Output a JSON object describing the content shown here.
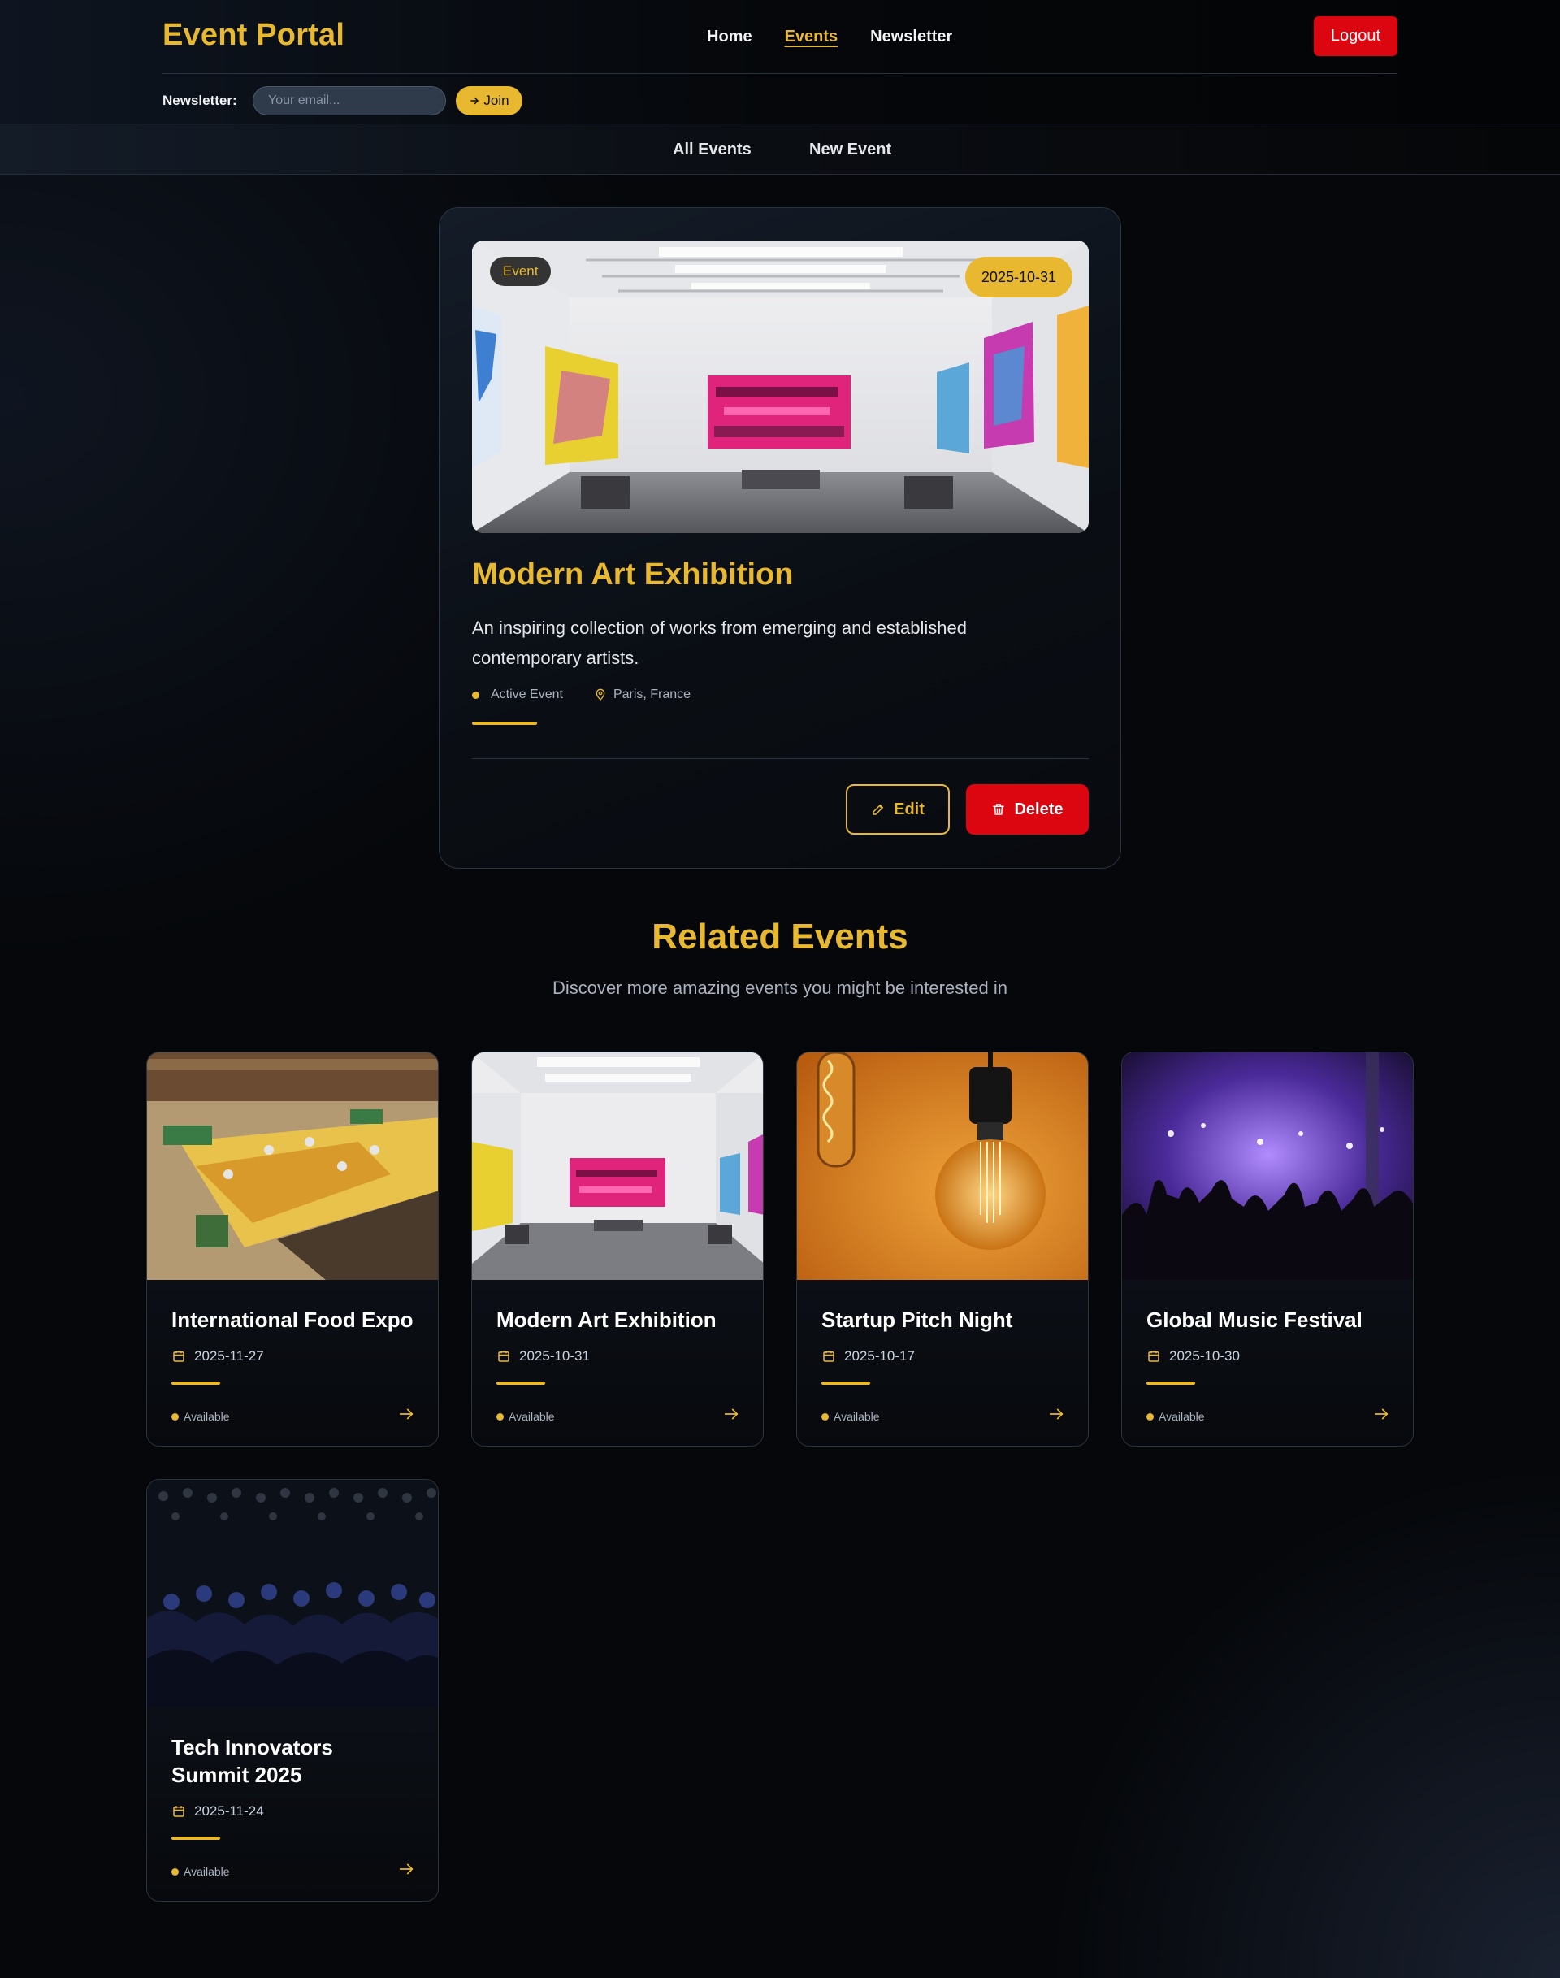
{
  "header": {
    "brand": "Event Portal",
    "nav": [
      {
        "label": "Home",
        "active": false
      },
      {
        "label": "Events",
        "active": true
      },
      {
        "label": "Newsletter",
        "active": false
      }
    ],
    "logout_label": "Logout",
    "newsletter_label": "Newsletter:",
    "newsletter_placeholder": "Your email...",
    "join_label": "Join"
  },
  "subnav": {
    "items": [
      {
        "label": "All Events"
      },
      {
        "label": "New Event"
      }
    ]
  },
  "event": {
    "badge": "Event",
    "date": "2025-10-31",
    "title": "Modern Art Exhibition",
    "description": "An inspiring collection of works from emerging and established contemporary artists.",
    "status": "Active Event",
    "location": "Paris, France",
    "edit_label": "Edit",
    "delete_label": "Delete"
  },
  "related": {
    "title": "Related Events",
    "subtitle": "Discover more amazing events you might be interested in",
    "items": [
      {
        "title": "International Food Expo",
        "date": "2025-11-27",
        "status": "Available",
        "image": "food-market"
      },
      {
        "title": "Modern Art Exhibition",
        "date": "2025-10-31",
        "status": "Available",
        "image": "art-gallery"
      },
      {
        "title": "Startup Pitch Night",
        "date": "2025-10-17",
        "status": "Available",
        "image": "light-bulb"
      },
      {
        "title": "Global Music Festival",
        "date": "2025-10-30",
        "status": "Available",
        "image": "concert-crowd"
      },
      {
        "title": "Tech Innovators Summit 2025",
        "date": "2025-11-24",
        "status": "Available",
        "image": "conference-audience"
      }
    ]
  },
  "colors": {
    "accent": "#e8b930",
    "danger": "#dc0611",
    "background": "#05070a"
  }
}
